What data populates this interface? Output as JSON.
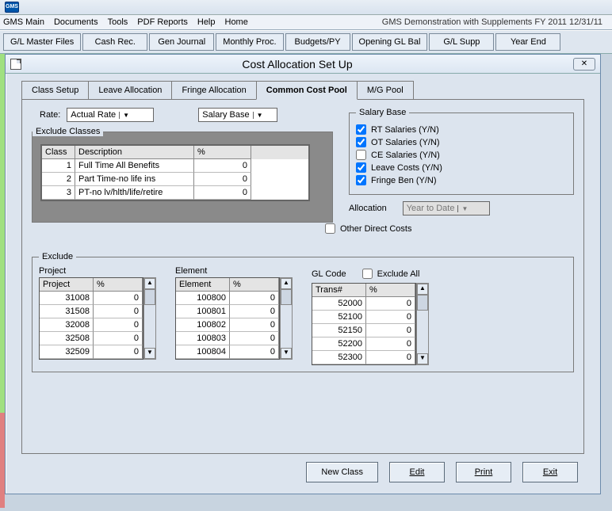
{
  "app_icon_text": "GMS",
  "menu": {
    "main": "GMS Main",
    "documents": "Documents",
    "tools": "Tools",
    "pdf": "PDF Reports",
    "help": "Help",
    "home": "Home"
  },
  "status_right": "GMS Demonstration with Supplements   FY 2011  12/31/11",
  "toolbar": [
    "G/L Master Files",
    "Cash Rec.",
    "Gen Journal",
    "Monthly Proc.",
    "Budgets/PY",
    "Opening GL Bal",
    "G/L Supp",
    "Year End"
  ],
  "window_title": "Cost Allocation Set Up",
  "tabs": {
    "t1": "Class Setup",
    "t2": "Leave Allocation",
    "t3": "Fringe Allocation",
    "t4": "Common Cost Pool",
    "t5": "M/G Pool"
  },
  "rate_label": "Rate:",
  "rate_value": "Actual Rate",
  "salary_base_dropdown": "Salary Base",
  "exclude_classes_legend": "Exclude Classes",
  "class_headers": {
    "c1": "Class",
    "c2": "Description",
    "c3": "%"
  },
  "class_rows": [
    {
      "class": "1",
      "desc": "Full Time All Benefits",
      "pct": "0"
    },
    {
      "class": "2",
      "desc": "Part Time-no life ins",
      "pct": "0"
    },
    {
      "class": "3",
      "desc": "PT-no lv/hlth/life/retire",
      "pct": "0"
    }
  ],
  "salary_base_legend": "Salary Base",
  "salary_checks": [
    {
      "label": "RT Salaries (Y/N)",
      "checked": true
    },
    {
      "label": "OT Salaries (Y/N)",
      "checked": true
    },
    {
      "label": "CE Salaries (Y/N)",
      "checked": false
    },
    {
      "label": "Leave Costs (Y/N)",
      "checked": true
    },
    {
      "label": "Fringe Ben (Y/N)",
      "checked": true
    }
  ],
  "allocation_label": "Allocation",
  "allocation_value": "Year to Date",
  "other_direct_label": "Other Direct Costs",
  "exclude_legend": "Exclude",
  "sub_labels": {
    "project": "Project",
    "element": "Element",
    "glcode": "GL Code",
    "exclude_all": "Exclude All"
  },
  "project_headers": {
    "h1": "Project",
    "h2": "%"
  },
  "project_rows": [
    {
      "a": "31008",
      "b": "0"
    },
    {
      "a": "31508",
      "b": "0"
    },
    {
      "a": "32008",
      "b": "0"
    },
    {
      "a": "32508",
      "b": "0"
    },
    {
      "a": "32509",
      "b": "0"
    }
  ],
  "element_headers": {
    "h1": "Element",
    "h2": "%"
  },
  "element_rows": [
    {
      "a": "100800",
      "b": "0"
    },
    {
      "a": "100801",
      "b": "0"
    },
    {
      "a": "100802",
      "b": "0"
    },
    {
      "a": "100803",
      "b": "0"
    },
    {
      "a": "100804",
      "b": "0"
    }
  ],
  "gl_headers": {
    "h1": "Trans#",
    "h2": "%"
  },
  "gl_rows": [
    {
      "a": "52000",
      "b": "0"
    },
    {
      "a": "52100",
      "b": "0"
    },
    {
      "a": "52150",
      "b": "0"
    },
    {
      "a": "52200",
      "b": "0"
    },
    {
      "a": "52300",
      "b": "0"
    }
  ],
  "buttons": {
    "new": "New Class",
    "edit": "Edit",
    "print": "Print",
    "exit": "Exit"
  }
}
